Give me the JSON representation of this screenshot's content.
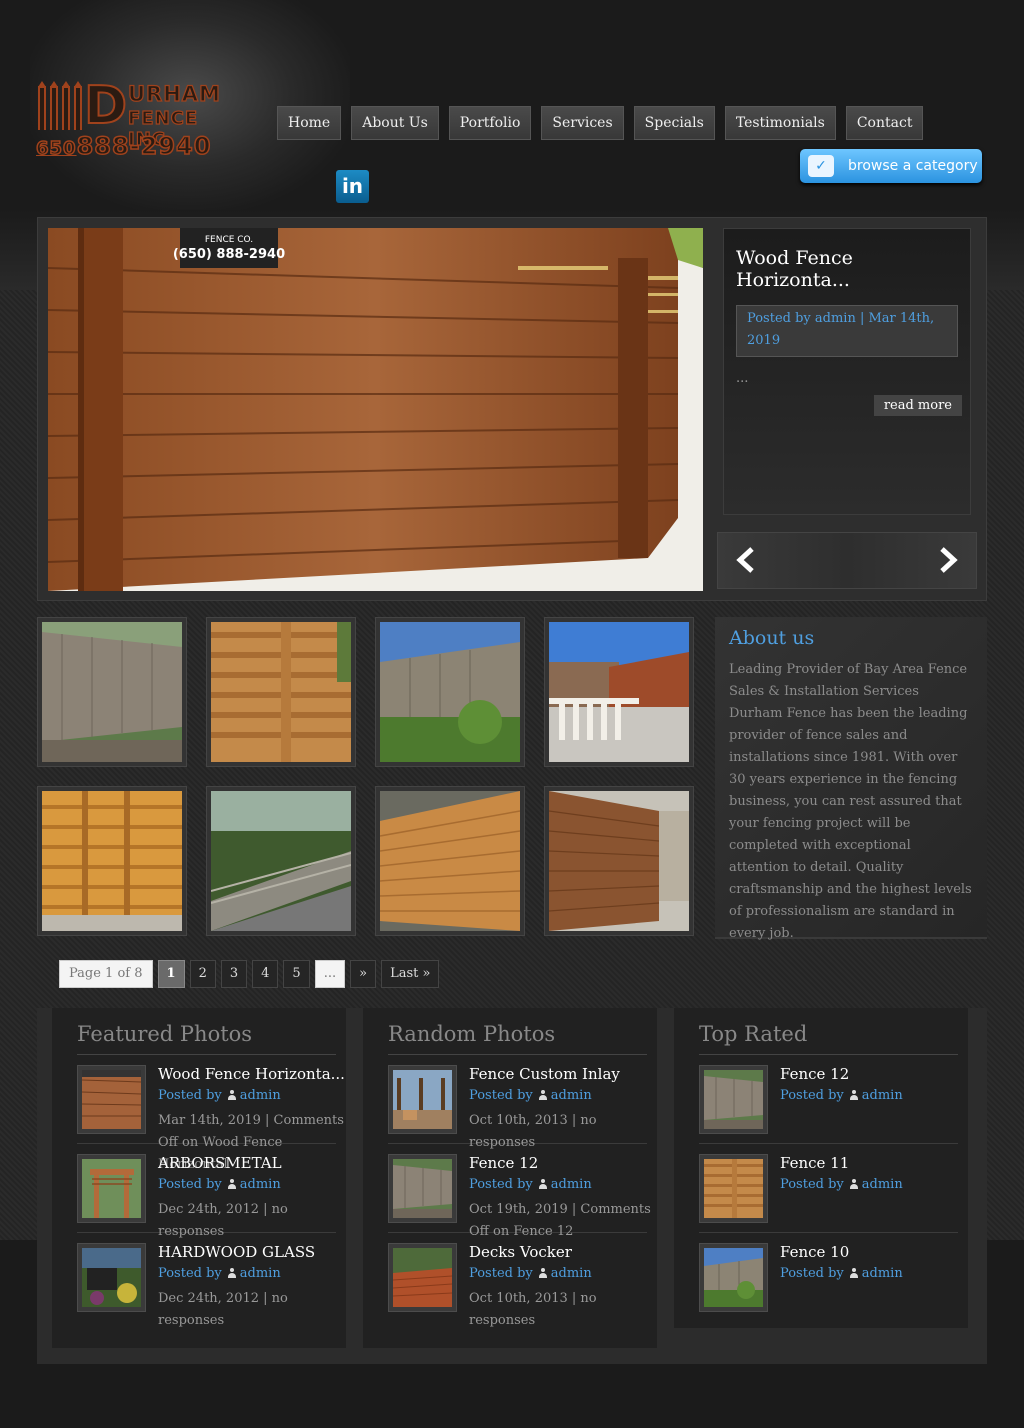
{
  "logo": {
    "line1": "URHAM",
    "line2": "FENCE INC.",
    "letter": "D",
    "area_code": "650",
    "phone": "888-2940"
  },
  "nav": [
    "Home",
    "About Us",
    "Portfolio",
    "Services",
    "Specials",
    "Testimonials",
    "Contact"
  ],
  "social": {
    "linkedin_label": "in"
  },
  "browse_label": "browse a category",
  "slider": {
    "title": "Wood Fence Horizonta...",
    "meta": "Posted by admin | Mar 14th, 2019",
    "excerpt": "...",
    "read_more": "read more",
    "sign_text": "(650) 888-2940",
    "sign_top": "FENCE CO."
  },
  "about": {
    "title": "About us",
    "text": "Leading Provider of Bay Area Fence Sales & Installation Services Durham Fence has been the leading provider of fence sales and installations since 1981. With over 30 years experience in the fencing business, you can rest assured that your fencing project will be completed with exceptional attention to detail. Quality craftsmanship and the highest levels of professionalism are standard in every job."
  },
  "pagination": {
    "info": "Page 1 of 8",
    "current": "1",
    "pages": [
      "2",
      "3",
      "4",
      "5"
    ],
    "dots": "...",
    "next": "»",
    "last": "Last »"
  },
  "featured": {
    "title": "Featured Photos",
    "items": [
      {
        "title": "Wood Fence Horizonta...",
        "by": "Posted by",
        "author": "admin",
        "date": "Mar 14th, 2019 | Comments Off on Wood Fence Horizontal"
      },
      {
        "title": "ARBORSMETAL",
        "by": "Posted by",
        "author": "admin",
        "date": "Dec 24th, 2012 | no responses"
      },
      {
        "title": "HARDWOOD GLASS",
        "by": "Posted by",
        "author": "admin",
        "date": "Dec 24th, 2012 | no responses"
      }
    ]
  },
  "random": {
    "title": "Random Photos",
    "items": [
      {
        "title": "Fence Custom Inlay",
        "by": "Posted by",
        "author": "admin",
        "date": "Oct 10th, 2013 | no responses"
      },
      {
        "title": "Fence 12",
        "by": "Posted by",
        "author": "admin",
        "date": "Oct 19th, 2019 | Comments Off on Fence 12"
      },
      {
        "title": "Decks Vocker",
        "by": "Posted by",
        "author": "admin",
        "date": "Oct 10th, 2013 | no responses"
      }
    ]
  },
  "top_rated": {
    "title": "Top Rated",
    "items": [
      {
        "title": "Fence 12",
        "by": "Posted by",
        "author": "admin"
      },
      {
        "title": "Fence 11",
        "by": "Posted by",
        "author": "admin"
      },
      {
        "title": "Fence 10",
        "by": "Posted by",
        "author": "admin"
      }
    ]
  },
  "colors": {
    "accent": "#4f9fe0",
    "logo": "#a0421c",
    "background": "#1b1b1b"
  }
}
